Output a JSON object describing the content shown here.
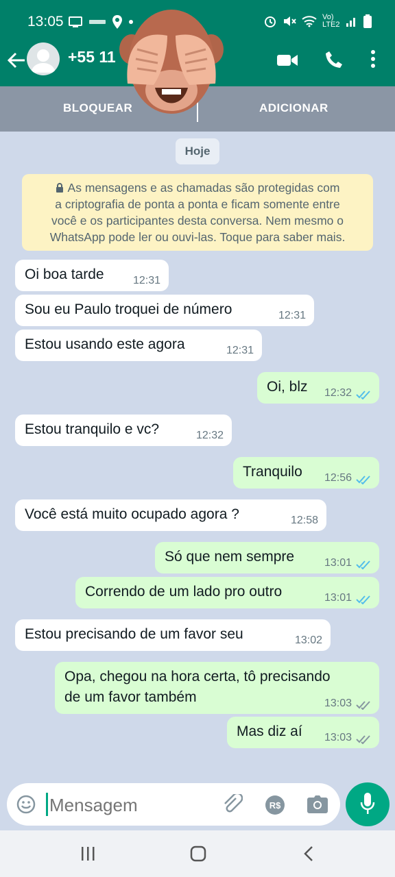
{
  "status_bar": {
    "time": "13:05",
    "network_label": "Vo) LTE2"
  },
  "header": {
    "contact_name": "+55 11"
  },
  "tabs": {
    "left_label": "BLOQUEAR",
    "right_label": "ADICIONAR"
  },
  "chat": {
    "date_label": "Hoje",
    "encryption_notice": [
      "As mensagens e as chamadas são protegidas com",
      "a criptografia de ponta a ponta e ficam somente entre",
      "você e os participantes desta conversa. Nem mesmo o",
      "WhatsApp pode ler ou ouvi-las. Toque para saber mais."
    ],
    "messages": [
      {
        "dir": "in",
        "text": "Oi boa tarde",
        "time": "12:31"
      },
      {
        "dir": "in",
        "text": "Sou eu Paulo troquei de número",
        "time": "12:31"
      },
      {
        "dir": "in",
        "text": "Estou usando este agora",
        "time": "12:31"
      },
      {
        "dir": "out",
        "text": "Oi, blz",
        "time": "12:32",
        "status": "read"
      },
      {
        "dir": "in",
        "text": "Estou tranquilo e vc?",
        "time": "12:32"
      },
      {
        "dir": "out",
        "text": "Tranquilo",
        "time": "12:56",
        "status": "read"
      },
      {
        "dir": "in",
        "text": "Você está muito ocupado agora ?",
        "time": "12:58"
      },
      {
        "dir": "out",
        "text": "Só que nem sempre",
        "time": "13:01",
        "status": "read"
      },
      {
        "dir": "out",
        "text": "Correndo de um lado pro outro",
        "time": "13:01",
        "status": "read"
      },
      {
        "dir": "in",
        "text": "Estou precisando de um favor seu",
        "time": "13:02"
      },
      {
        "dir": "out",
        "text": "Opa, chegou na hora certa, tô precisando",
        "text2": "de um favor também",
        "time": "13:03",
        "status": "delivered"
      },
      {
        "dir": "out",
        "text": "Mas diz aí",
        "time": "13:03",
        "status": "delivered"
      }
    ]
  },
  "composer": {
    "placeholder": "Mensagem"
  },
  "colors": {
    "brand": "#008069",
    "chat_bg": "#cfd9ea",
    "out_bubble": "#d9fdd3",
    "in_bubble": "#ffffff",
    "read_tick": "#53bdeb",
    "delivered_tick": "#8696a0",
    "mic_button": "#00a884"
  },
  "icons": [
    "back-arrow-icon",
    "video-call-icon",
    "phone-icon",
    "more-options-icon",
    "lock-icon",
    "emoji-icon",
    "attach-icon",
    "payment-icon",
    "camera-icon",
    "mic-icon",
    "recent-apps-icon",
    "home-icon",
    "nav-back-icon",
    "see-no-evil-monkey-sticker"
  ]
}
